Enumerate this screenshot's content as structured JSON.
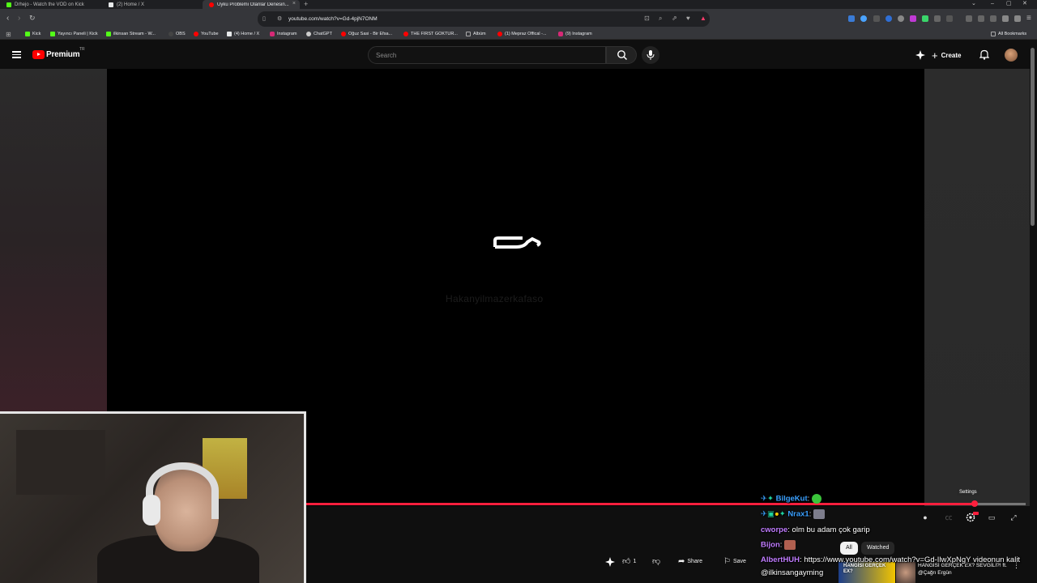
{
  "browser": {
    "tabs": [
      {
        "title": "Drhejo - Watch the VOD on Kick",
        "color": "#53fc18"
      },
      {
        "title": "(2) Home / X",
        "color": "#e7e9ea"
      },
      {
        "title": "Uyku Problemi Olanlar Denesin...",
        "color": "#ff0000",
        "close": "×"
      }
    ],
    "new_tab": "+",
    "url": "youtube.com/watch?v=Gd-4pjN7ONM",
    "bookmarks": [
      {
        "label": "Kick",
        "color": "#53fc18"
      },
      {
        "label": "Yayıncı Paneli | Kick",
        "color": "#53fc18"
      },
      {
        "label": "ilkinsan Stream - W...",
        "color": "#53fc18"
      },
      {
        "label": "OBS",
        "color": "#444444"
      },
      {
        "label": "YouTube",
        "color": "#ff0000"
      },
      {
        "label": "(4) Home / X",
        "color": "#e7e9ea"
      },
      {
        "label": "Instagram",
        "color": "#d62976"
      },
      {
        "label": "ChatGPT",
        "color": "#cccccc"
      },
      {
        "label": "Oğuz Sasi - Bir Efsa...",
        "color": "#ff0000"
      },
      {
        "label": "THE FIRST GOKTUR...",
        "color": "#ff0000"
      },
      {
        "label": "Albüm",
        "color": "#888888"
      },
      {
        "label": "(1) Mepraz Offical -...",
        "color": "#ff0000"
      },
      {
        "label": "(9) Instagram",
        "color": "#d62976"
      }
    ],
    "all_bookmarks": "All Bookmarks"
  },
  "youtube": {
    "logo_text": "Premium",
    "country": "TR",
    "search_placeholder": "Search",
    "create_label": "Create"
  },
  "player": {
    "watermark": "Hakanyilmazerkafaso",
    "progress_fraction": 0.93,
    "tooltip": "Settings"
  },
  "below": {
    "chips": [
      "All",
      "Watched"
    ],
    "like_count": "1",
    "share_label": "Share",
    "save_label": "Save",
    "suggested_title": "HANGİSİ GERÇEK EX? SEVGİLİ?! ft. @Çağrı Ergün",
    "thumb_text": "HANGİSİ GERÇEK EX?"
  },
  "chat": [
    {
      "user": "BilgeKut",
      "message": "",
      "color": "#3aa0ff"
    },
    {
      "user": "Nrax1",
      "message": "",
      "color": "#3aa0ff"
    },
    {
      "user": "cworpe",
      "message": "olm bu adam çok garip",
      "color": "#c07cff"
    },
    {
      "user": "Bijon",
      "message": "",
      "color": "#c07cff"
    },
    {
      "user": "AlbertHUH",
      "message": "https://www.youtube.com/watch?v=Gd-IlwXpNgY videonun kalit",
      "color": "#c07cff"
    },
    {
      "user": "",
      "message": "@ilkinsangayming",
      "color": "#ffffff"
    }
  ]
}
